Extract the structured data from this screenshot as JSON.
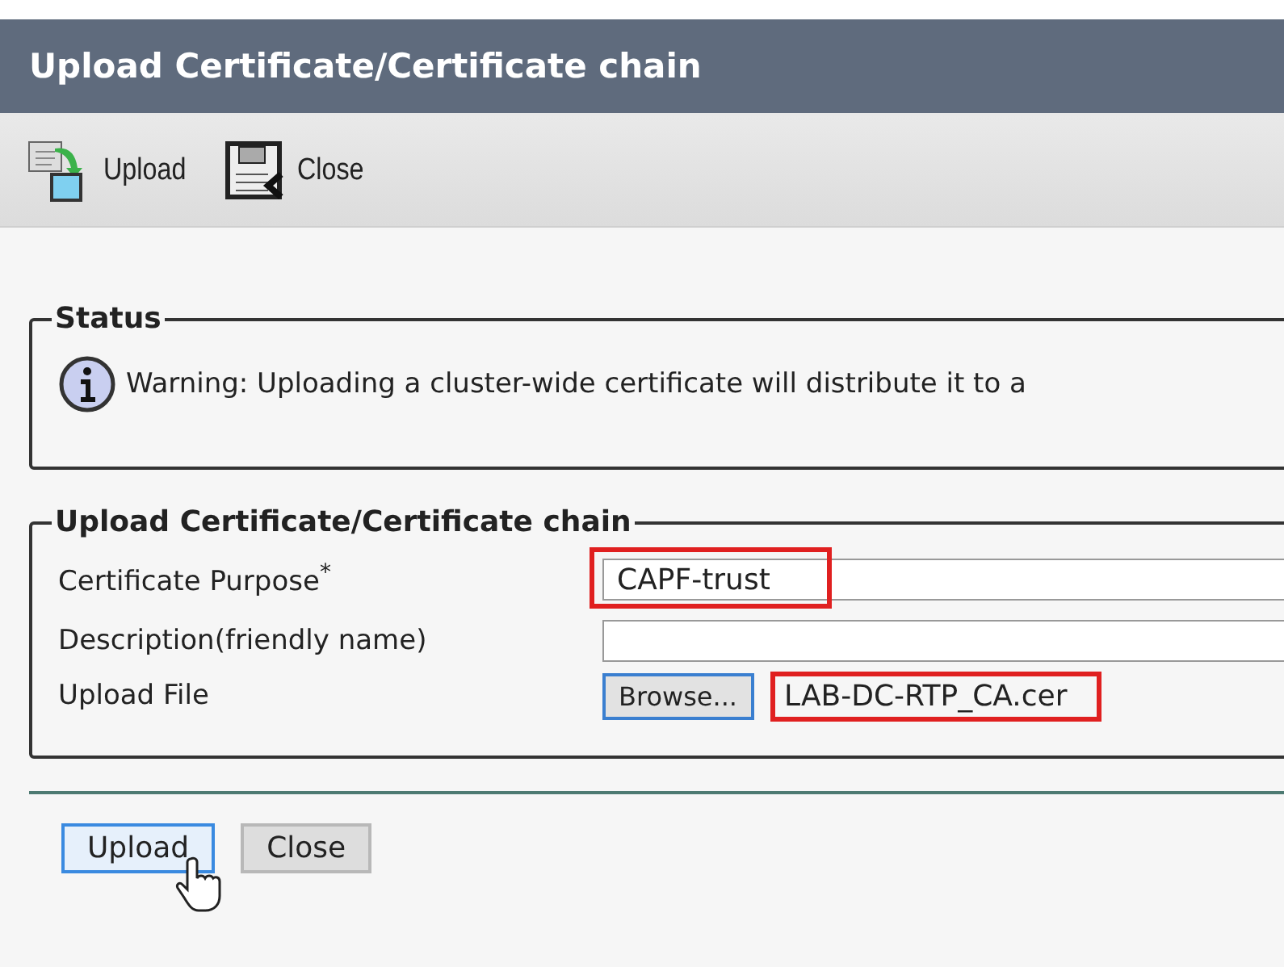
{
  "window": {
    "title": "Upload Certificate/Certificate chain"
  },
  "toolbar": [
    {
      "kind": "upload",
      "label": "Upload"
    },
    {
      "kind": "close",
      "label": "Close"
    }
  ],
  "status": {
    "legend": "Status",
    "message": "Warning: Uploading a cluster-wide certificate will distribute it to a"
  },
  "form": {
    "legend": "Upload Certificate/Certificate chain",
    "fields": [
      {
        "kind": "text",
        "label": "Certificate Purpose",
        "required_mark": "*",
        "value": "CAPF-trust",
        "highlighted": true
      },
      {
        "kind": "text",
        "label": "Description(friendly name)",
        "highlighted": false
      },
      {
        "kind": "file",
        "label": "Upload File",
        "button": "Browse...",
        "value": "LAB-DC-RTP_CA.cer",
        "highlighted": true
      }
    ]
  },
  "buttons": [
    {
      "label": "Upload",
      "focused": true
    },
    {
      "label": "Close",
      "focused": false
    }
  ]
}
